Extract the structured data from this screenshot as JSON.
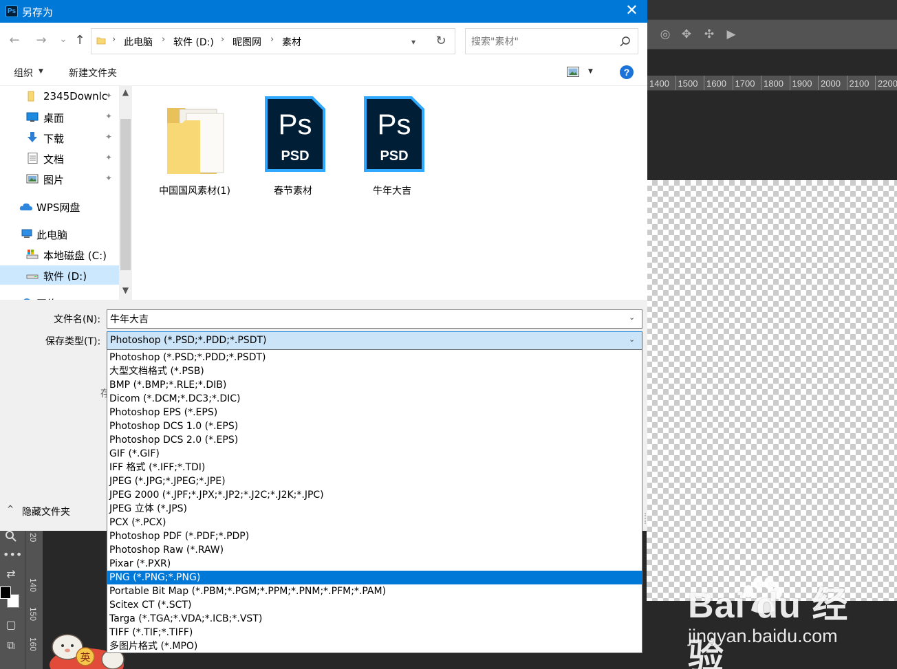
{
  "dialog": {
    "title": "另存为",
    "app_icon_text": "Ps",
    "close_glyph": "✕"
  },
  "nav": {
    "back_glyph": "←",
    "forward_glyph": "→",
    "history_glyph": "⌄",
    "up_glyph": "↑",
    "breadcrumbs": [
      "此电脑",
      "软件 (D:)",
      "昵图网",
      "素材"
    ],
    "breadcrumb_sep": "›",
    "refresh_glyph": "↻",
    "search_placeholder": "搜索\"素材\""
  },
  "toolbar": {
    "organize": "组织",
    "new_folder": "新建文件夹",
    "help": "?"
  },
  "sidebar": {
    "items": [
      {
        "label": "2345Downlc",
        "icon": "folder-icon",
        "pinned": true
      },
      {
        "label": "桌面",
        "icon": "desktop-icon",
        "pinned": true
      },
      {
        "label": "下载",
        "icon": "download-icon",
        "pinned": true
      },
      {
        "label": "文档",
        "icon": "document-icon",
        "pinned": true
      },
      {
        "label": "图片",
        "icon": "pictures-icon",
        "pinned": true
      },
      {
        "label": "WPS网盘",
        "icon": "cloud-icon",
        "pinned": false
      },
      {
        "label": "此电脑",
        "icon": "computer-icon",
        "pinned": false
      },
      {
        "label": "本地磁盘 (C:)",
        "icon": "drive-c-icon",
        "pinned": false
      },
      {
        "label": "软件 (D:)",
        "icon": "drive-d-icon",
        "pinned": false,
        "selected": true
      },
      {
        "label": "网络",
        "icon": "network-icon",
        "pinned": false
      }
    ],
    "pin_glyph": "📌"
  },
  "files": [
    {
      "name": "中国国风素材(1)",
      "type": "folder"
    },
    {
      "name": "春节素材",
      "type": "psd"
    },
    {
      "name": "牛年大吉",
      "type": "psd"
    }
  ],
  "psd_icon": {
    "top": "Ps",
    "bottom": "PSD",
    "bg": "#001e36",
    "accent": "#31a8ff"
  },
  "form": {
    "filename_label": "文件名(N):",
    "filename_value": "牛年大吉",
    "filetype_label": "保存类型(T):",
    "filetype_value": "Photoshop (*.PSD;*.PDD;*.PSDT)",
    "partial_label": "存",
    "hide_folders": "隐藏文件夹"
  },
  "filetypes": [
    "Photoshop (*.PSD;*.PDD;*.PSDT)",
    "大型文档格式 (*.PSB)",
    "BMP (*.BMP;*.RLE;*.DIB)",
    "Dicom (*.DCM;*.DC3;*.DIC)",
    "Photoshop EPS (*.EPS)",
    "Photoshop DCS 1.0 (*.EPS)",
    "Photoshop DCS 2.0 (*.EPS)",
    "GIF (*.GIF)",
    "IFF 格式 (*.IFF;*.TDI)",
    "JPEG (*.JPG;*.JPEG;*.JPE)",
    "JPEG 2000 (*.JPF;*.JPX;*.JP2;*.J2C;*.J2K;*.JPC)",
    "JPEG 立体 (*.JPS)",
    "PCX (*.PCX)",
    "Photoshop PDF (*.PDF;*.PDP)",
    "Photoshop Raw (*.RAW)",
    "Pixar (*.PXR)",
    "PNG (*.PNG;*.PNG)",
    "Portable Bit Map (*.PBM;*.PGM;*.PPM;*.PNM;*.PFM;*.PAM)",
    "Scitex CT (*.SCT)",
    "Targa (*.TGA;*.VDA;*.ICB;*.VST)",
    "TIFF (*.TIF;*.TIFF)",
    "多图片格式 (*.MPO)"
  ],
  "filetype_highlighted": "PNG (*.PNG;*.PNG)",
  "photoshop": {
    "ruler_ticks": [
      "1400",
      "1500",
      "1600",
      "1700",
      "1800",
      "1900",
      "2000",
      "2100",
      "2200"
    ],
    "vruler_labels": [
      "20",
      "140",
      "150",
      "160"
    ],
    "toolbar_icons": [
      "rotate-3d-icon",
      "pan-3d-icon",
      "slide-3d-icon",
      "camera-3d-icon"
    ]
  },
  "watermark": {
    "logo": "Bai  du 经验",
    "url": "jingyan.baidu.com"
  },
  "colors": {
    "accent": "#0078d7",
    "selection": "#cce8ff",
    "highlight": "#0078d7"
  }
}
